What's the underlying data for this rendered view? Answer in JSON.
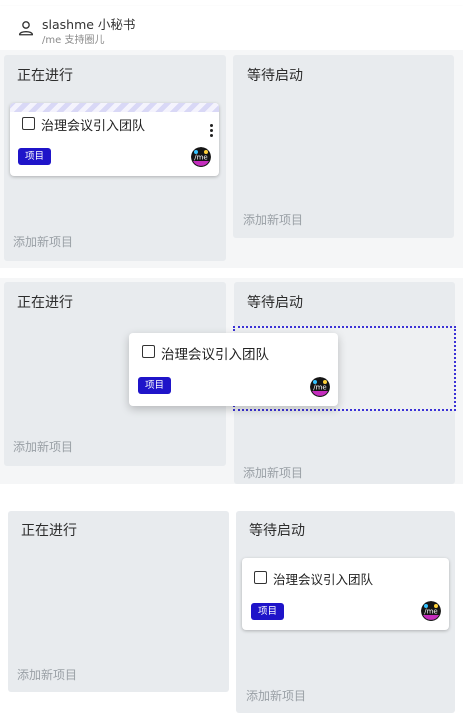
{
  "header": {
    "title": "slashme 小秘书",
    "subtitle": "/me 支持圈儿",
    "icon": "user-icon"
  },
  "columns": {
    "in_progress": "正在进行",
    "waiting": "等待启动",
    "add_item": "添加新项目"
  },
  "card": {
    "title": "治理会议引入团队",
    "tag": "项目",
    "avatar_text": "/me"
  },
  "colors": {
    "column_bg": "#e8ebee",
    "tag_bg": "#1f14c9",
    "drop_outline": "#3b32d6"
  }
}
